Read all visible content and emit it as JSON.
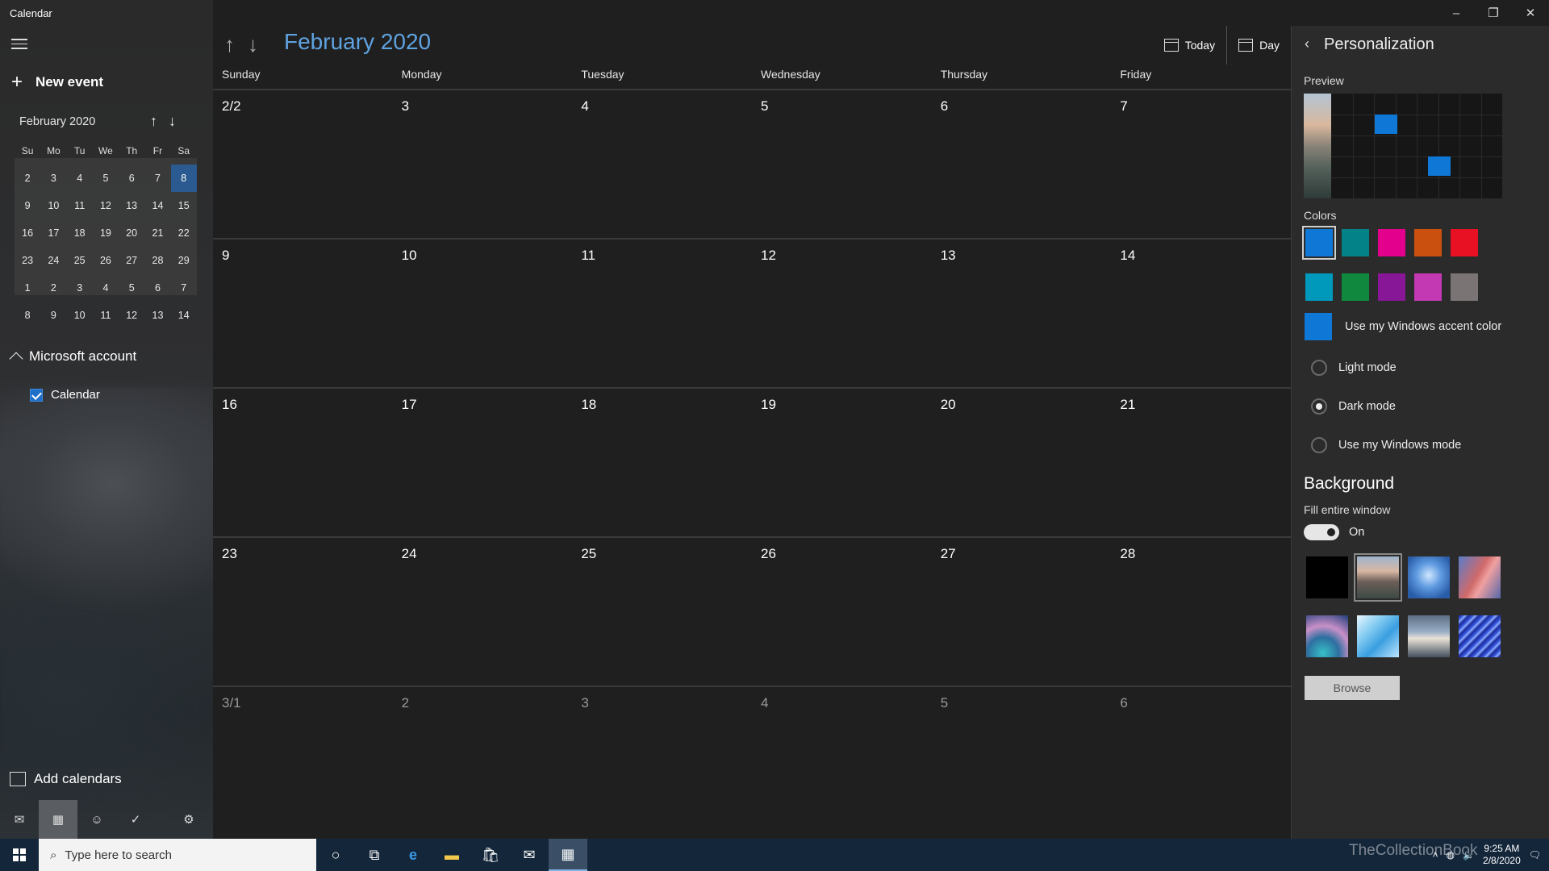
{
  "window": {
    "title": "Calendar",
    "controls": {
      "minimize": "–",
      "restore": "❐",
      "close": "✕"
    }
  },
  "sidebar": {
    "new_event": "New event",
    "mini_calendar": {
      "title": "February 2020",
      "weekdays": [
        "Su",
        "Mo",
        "Tu",
        "We",
        "Th",
        "Fr",
        "Sa"
      ],
      "weeks": [
        [
          "2",
          "3",
          "4",
          "5",
          "6",
          "7",
          "8"
        ],
        [
          "9",
          "10",
          "11",
          "12",
          "13",
          "14",
          "15"
        ],
        [
          "16",
          "17",
          "18",
          "19",
          "20",
          "21",
          "22"
        ],
        [
          "23",
          "24",
          "25",
          "26",
          "27",
          "28",
          "29"
        ],
        [
          "1",
          "2",
          "3",
          "4",
          "5",
          "6",
          "7"
        ],
        [
          "8",
          "9",
          "10",
          "11",
          "12",
          "13",
          "14"
        ]
      ],
      "selected": "8"
    },
    "account": "Microsoft account",
    "calendar_item": "Calendar",
    "add_calendars": "Add calendars"
  },
  "main": {
    "month_title": "February 2020",
    "today_label": "Today",
    "view_label": "Day",
    "weekdays": [
      "Sunday",
      "Monday",
      "Tuesday",
      "Wednesday",
      "Thursday",
      "Friday"
    ],
    "weeks": [
      [
        "2/2",
        "3",
        "4",
        "5",
        "6",
        "7"
      ],
      [
        "9",
        "10",
        "11",
        "12",
        "13",
        "14"
      ],
      [
        "16",
        "17",
        "18",
        "19",
        "20",
        "21"
      ],
      [
        "23",
        "24",
        "25",
        "26",
        "27",
        "28"
      ],
      [
        "3/1",
        "2",
        "3",
        "4",
        "5",
        "6"
      ]
    ]
  },
  "personalization": {
    "title": "Personalization",
    "preview_label": "Preview",
    "colors_label": "Colors",
    "colors": [
      "#0f78d7",
      "#038387",
      "#e3008c",
      "#ca5010",
      "#e81123",
      "#0099bc",
      "#10893e",
      "#881798",
      "#c239b3",
      "#7a7574"
    ],
    "accent_color_label": "Use my Windows accent color",
    "modes": [
      "Light mode",
      "Dark mode",
      "Use my Windows mode"
    ],
    "selected_mode": "Dark mode",
    "background_title": "Background",
    "fill_label": "Fill entire window",
    "toggle_state": "On",
    "browse_label": "Browse"
  },
  "taskbar": {
    "search_placeholder": "Type here to search",
    "time": "9:25 AM",
    "date": "2/8/2020",
    "watermark": "TheCollectionBook"
  }
}
